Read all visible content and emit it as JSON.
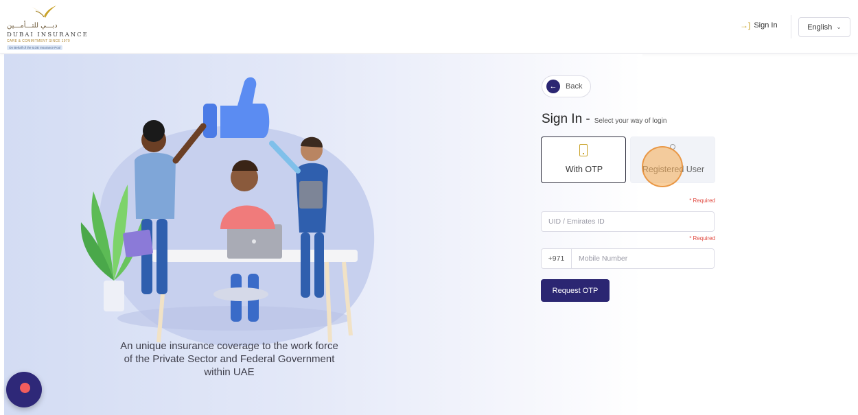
{
  "header": {
    "logo": {
      "arabic_text": "دبـــي للتـــأمـــين",
      "name": "DUBAI INSURANCE",
      "tagline": "CARE & COMMITMENT SINCE 1970",
      "pill": "On Behalf of the ILOE Insurance Pool"
    },
    "signin_label": "Sign In",
    "language": "English"
  },
  "left": {
    "tagline_line1": "An unique insurance coverage to the work force",
    "tagline_line2": "of the Private Sector and Federal Government",
    "tagline_line3": "within UAE"
  },
  "form": {
    "back_label": "Back",
    "title": "Sign In -",
    "subtitle": "Select your way of login",
    "options": [
      {
        "label": "With OTP",
        "icon": "phone-icon",
        "selected": true
      },
      {
        "label": "Registered User",
        "icon": "user-icon",
        "selected": false
      }
    ],
    "required_label": "* Required",
    "uid_placeholder": "UID / Emirates ID",
    "country_code": "+971",
    "mobile_placeholder": "Mobile Number",
    "submit_label": "Request OTP"
  },
  "colors": {
    "primary": "#2b2672",
    "accent_gold": "#c9a227",
    "required_red": "#e0473e",
    "highlight_orange": "#f4aa50"
  }
}
